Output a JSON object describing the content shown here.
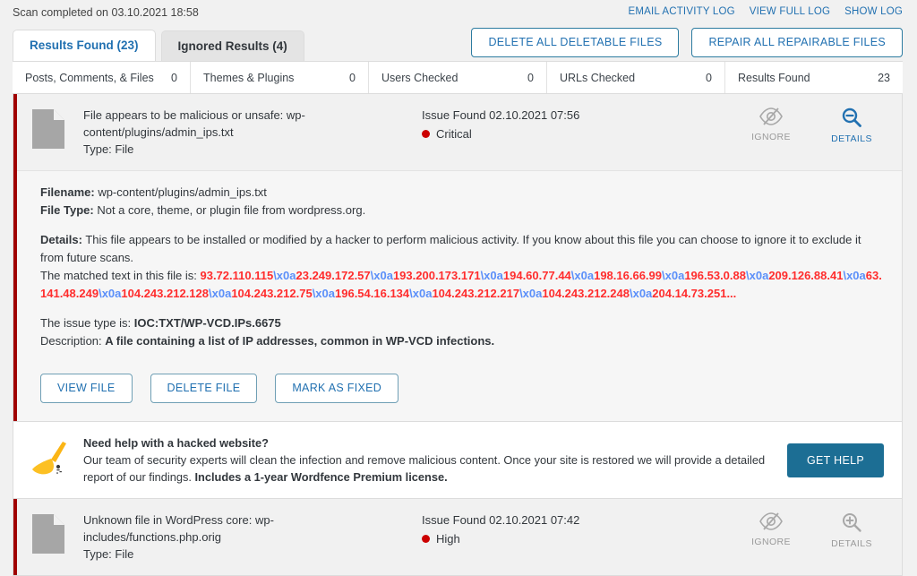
{
  "topbar": {
    "scan_status": "Scan completed on 03.10.2021 18:58",
    "links": [
      {
        "label": "EMAIL ACTIVITY LOG",
        "name": "email-activity-log-link"
      },
      {
        "label": "VIEW FULL LOG",
        "name": "view-full-log-link"
      },
      {
        "label": "SHOW LOG",
        "name": "show-log-link"
      }
    ]
  },
  "tabs": [
    {
      "label": "Results Found (23)",
      "active": true
    },
    {
      "label": "Ignored Results (4)",
      "active": false
    }
  ],
  "top_buttons": [
    {
      "label": "DELETE ALL DELETABLE FILES"
    },
    {
      "label": "REPAIR ALL REPAIRABLE FILES"
    }
  ],
  "stats": [
    {
      "label": "Posts, Comments, & Files",
      "value": "0"
    },
    {
      "label": "Themes & Plugins",
      "value": "0"
    },
    {
      "label": "Users Checked",
      "value": "0"
    },
    {
      "label": "URLs Checked",
      "value": "0"
    },
    {
      "label": "Results Found",
      "value": "23"
    }
  ],
  "results": [
    {
      "title": "File appears to be malicious or unsafe: wp-content/plugins/admin_ips.txt",
      "type_line": "Type: File",
      "issue_found": "Issue Found 02.10.2021 07:56",
      "severity": "Critical",
      "severity_color": "#cc0000",
      "ignore_label": "IGNORE",
      "details_label": "DETAILS",
      "expanded": true,
      "details": {
        "filename_label": "Filename:",
        "filename_value": "wp-content/plugins/admin_ips.txt",
        "filetype_label": "File Type:",
        "filetype_value": "Not a core, theme, or plugin file from wordpress.org.",
        "details_label": "Details:",
        "details_text": "This file appears to be installed or modified by a hacker to perform malicious activity. If you know about this file you can choose to ignore it to exclude it from future scans.",
        "matched_prefix": "The matched text in this file is:",
        "matched_separator": "\\x0a",
        "matched_ips": [
          "93.72.110.115",
          "23.249.172.57",
          "193.200.173.171",
          "194.60.77.44",
          "198.16.66.99",
          "196.53.0.88",
          "209.126.88.41",
          "63.141.48.249",
          "104.243.212.128",
          "104.243.212.75",
          "196.54.16.134",
          "104.243.212.217",
          "104.243.212.248",
          "204.14.73.251"
        ],
        "matched_ellipsis": "...",
        "issue_type_label": "The issue type is:",
        "issue_type_value": "IOC:TXT/WP-VCD.IPs.6675",
        "description_label": "Description:",
        "description_value": "A file containing a list of IP addresses, common in WP-VCD infections.",
        "buttons": [
          {
            "label": "VIEW FILE"
          },
          {
            "label": "DELETE FILE"
          },
          {
            "label": "MARK AS FIXED"
          }
        ]
      }
    },
    {
      "title": "Unknown file in WordPress core: wp-includes/functions.php.orig",
      "type_line": "Type: File",
      "issue_found": "Issue Found 02.10.2021 07:42",
      "severity": "High",
      "severity_color": "#cc0000",
      "ignore_label": "IGNORE",
      "details_label": "DETAILS",
      "expanded": false
    }
  ],
  "promo": {
    "heading": "Need help with a hacked website?",
    "body_1": "Our team of security experts will clean the infection and remove malicious content. Once your site is restored we will provide a detailed report of our findings.",
    "body_2": "Includes a 1-year Wordfence Premium license.",
    "button_label": "GET HELP",
    "button_color": "#1c6e94"
  },
  "theme": {
    "accent": "#2271b1",
    "severity_bar": "#a00000",
    "ip_red": "#ff2d2d",
    "escape_blue": "#5b8ff9"
  }
}
